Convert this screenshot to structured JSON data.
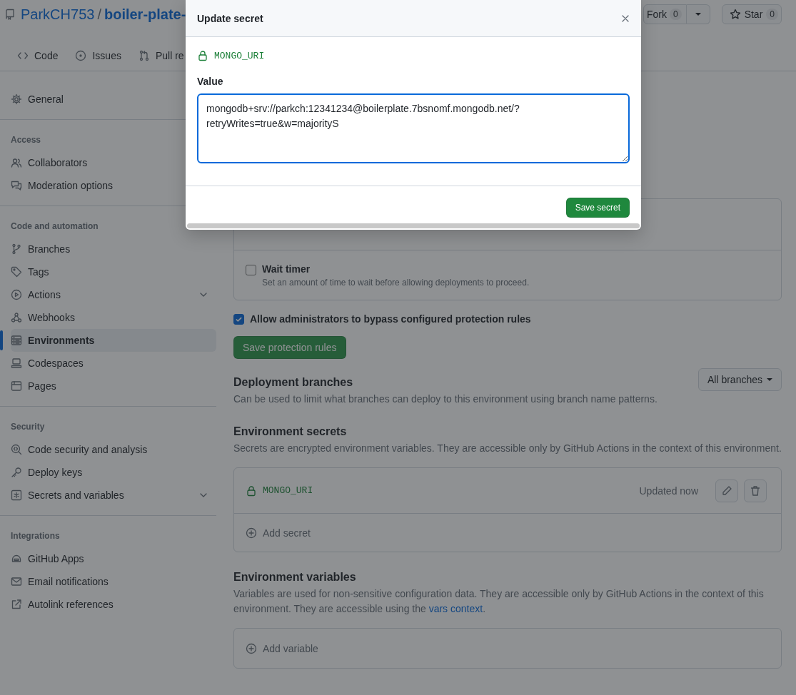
{
  "repo": {
    "owner": "ParkCH753",
    "separator": "/",
    "name": "boiler-plate-"
  },
  "repo_actions": [
    {
      "kind": "fork",
      "label": "Fork",
      "count": "0"
    },
    {
      "kind": "star",
      "label": "Star",
      "count": "0"
    }
  ],
  "tabs": [
    {
      "label": "Code",
      "selected": false
    },
    {
      "label": "Issues",
      "selected": false
    },
    {
      "label": "Pull re",
      "selected": false
    }
  ],
  "sidebar": [
    {
      "items": [
        {
          "label": "General",
          "selected": false
        }
      ]
    },
    {
      "heading": "Access",
      "items": [
        {
          "label": "Collaborators",
          "selected": false
        },
        {
          "label": "Moderation options",
          "selected": false
        }
      ]
    },
    {
      "heading": "Code and automation",
      "items": [
        {
          "label": "Branches",
          "selected": false
        },
        {
          "label": "Tags",
          "selected": false
        },
        {
          "label": "Actions",
          "selected": false,
          "expanded": false
        },
        {
          "label": "Webhooks",
          "selected": false
        },
        {
          "label": "Environments",
          "selected": true
        },
        {
          "label": "Codespaces",
          "selected": false
        },
        {
          "label": "Pages",
          "selected": false
        }
      ]
    },
    {
      "heading": "Security",
      "items": [
        {
          "label": "Code security and analysis",
          "selected": false
        },
        {
          "label": "Deploy keys",
          "selected": false
        },
        {
          "label": "Secrets and variables",
          "selected": false,
          "expanded": false
        }
      ]
    },
    {
      "heading": "Integrations",
      "items": [
        {
          "label": "GitHub Apps",
          "selected": false
        },
        {
          "label": "Email notifications",
          "selected": false
        },
        {
          "label": "Autolink references",
          "selected": false
        }
      ]
    }
  ],
  "protection": {
    "wait_timer": {
      "label": "Wait timer",
      "description": "Set an amount of time to wait before allowing deployments to proceed.",
      "checked": false
    },
    "admin_bypass": {
      "label": "Allow administrators to bypass configured protection rules",
      "checked": true
    },
    "save_button": "Save protection rules"
  },
  "deployment_branches": {
    "title": "Deployment branches",
    "description": "Can be used to limit what branches can deploy to this environment using branch name patterns.",
    "dropdown": "All branches"
  },
  "secrets": {
    "title": "Environment secrets",
    "description": "Secrets are encrypted environment variables. They are accessible only by GitHub Actions in the context of this environment.",
    "items": [
      {
        "name": "MONGO_URI",
        "updated": "Updated now"
      }
    ],
    "add": "Add secret"
  },
  "variables": {
    "title": "Environment variables",
    "description": "Variables are used for non-sensitive configuration data. They are accessible only by GitHub Actions in the context of this environment. They are accessible using the ",
    "link": "vars context",
    "description_end": ".",
    "add": "Add variable"
  },
  "modal": {
    "title": "Update secret",
    "secret_name": "MONGO_URI",
    "field_label": "Value",
    "value": "mongodb+srv://parkch:12341234@boilerplate.7bsnomf.mongodb.net/?retryWrites=true&w=majorityS",
    "save": "Save secret"
  }
}
